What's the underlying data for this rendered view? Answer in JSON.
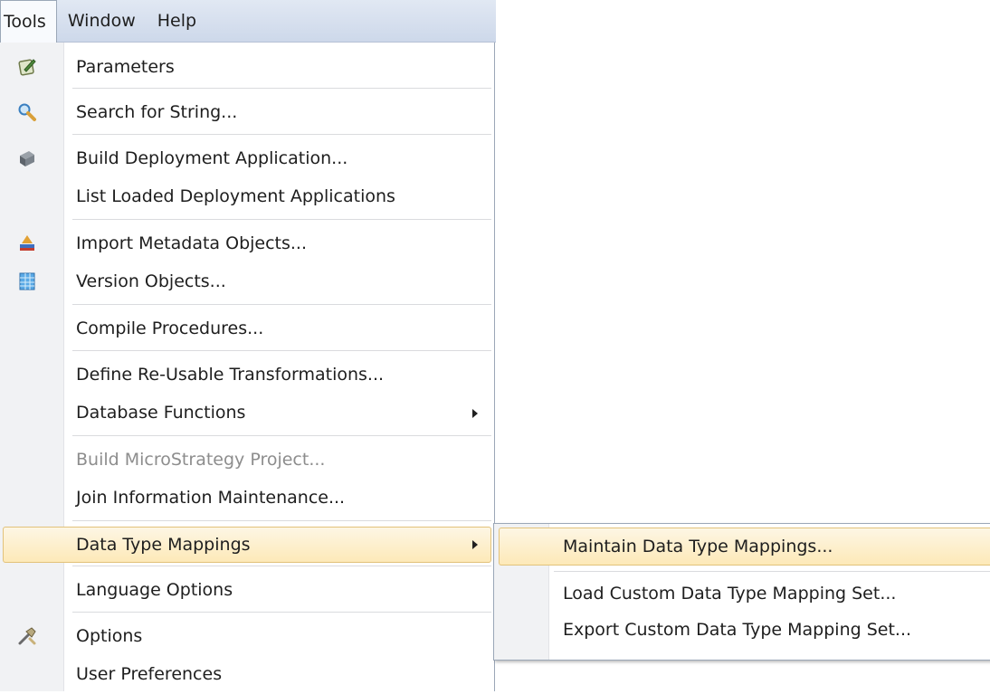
{
  "menubar": {
    "items": [
      {
        "label": "Tools"
      },
      {
        "label": "Window"
      },
      {
        "label": "Help"
      }
    ]
  },
  "tools_menu": {
    "items": [
      {
        "label": "Parameters",
        "icon": "parameters-icon"
      },
      {
        "label": "Search for String...",
        "icon": "search-icon"
      },
      {
        "label": "Build Deployment Application...",
        "icon": "deployment-icon"
      },
      {
        "label": "List Loaded Deployment Applications"
      },
      {
        "label": "Import Metadata Objects...",
        "icon": "import-icon"
      },
      {
        "label": "Version Objects...",
        "icon": "version-icon"
      },
      {
        "label": "Compile Procedures..."
      },
      {
        "label": "Define Re-Usable Transformations..."
      },
      {
        "label": "Database Functions",
        "has_submenu": true
      },
      {
        "label": "Build MicroStrategy Project...",
        "disabled": true
      },
      {
        "label": "Join Information Maintenance..."
      },
      {
        "label": "Data Type Mappings",
        "has_submenu": true,
        "highlighted": true
      },
      {
        "label": "Language Options"
      },
      {
        "label": "Options",
        "icon": "options-icon"
      },
      {
        "label": "User Preferences"
      }
    ]
  },
  "data_type_mappings_submenu": {
    "items": [
      {
        "label": "Maintain Data Type Mappings...",
        "highlighted": true
      },
      {
        "label": "Load Custom Data Type Mapping Set..."
      },
      {
        "label": "Export Custom Data Type Mapping Set..."
      }
    ]
  },
  "colors": {
    "highlight_fill": "#fde9b8",
    "highlight_border": "#e2c27a",
    "menubar": "#cdd8ea",
    "disabled_text": "#8d8d8d"
  }
}
